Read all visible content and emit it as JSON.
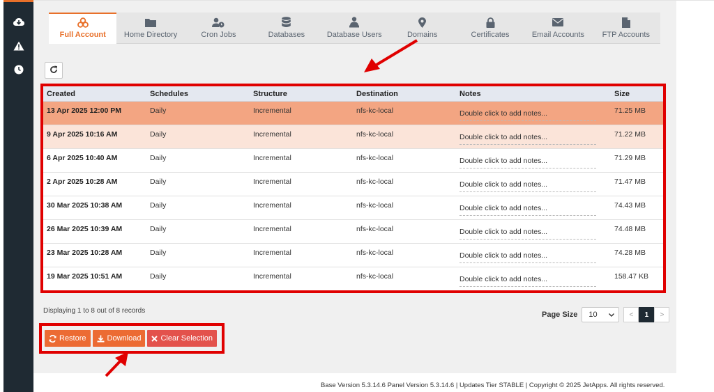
{
  "tabs": [
    {
      "label": "Full Account",
      "icon": "biohazard-icon",
      "active": true
    },
    {
      "label": "Home Directory",
      "icon": "folder-icon",
      "active": false
    },
    {
      "label": "Cron Jobs",
      "icon": "user-clock-icon",
      "active": false
    },
    {
      "label": "Databases",
      "icon": "database-icon",
      "active": false
    },
    {
      "label": "Database Users",
      "icon": "user-group-icon",
      "active": false
    },
    {
      "label": "Domains",
      "icon": "map-pin-icon",
      "active": false
    },
    {
      "label": "Certificates",
      "icon": "lock-icon",
      "active": false
    },
    {
      "label": "Email Accounts",
      "icon": "envelope-icon",
      "active": false
    },
    {
      "label": "FTP Accounts",
      "icon": "file-icon",
      "active": false
    }
  ],
  "table": {
    "headers": {
      "created": "Created",
      "schedules": "Schedules",
      "structure": "Structure",
      "destination": "Destination",
      "notes": "Notes",
      "size": "Size"
    },
    "rows": [
      {
        "created": "13 Apr 2025 12:00 PM",
        "schedules": "Daily",
        "structure": "Incremental",
        "destination": "nfs-kc-local",
        "notes": "Double click to add notes...",
        "size": "71.25 MB"
      },
      {
        "created": "9 Apr 2025 10:16 AM",
        "schedules": "Daily",
        "structure": "Incremental",
        "destination": "nfs-kc-local",
        "notes": "Double click to add notes...",
        "size": "71.22 MB"
      },
      {
        "created": "6 Apr 2025 10:40 AM",
        "schedules": "Daily",
        "structure": "Incremental",
        "destination": "nfs-kc-local",
        "notes": "Double click to add notes...",
        "size": "71.29 MB"
      },
      {
        "created": "2 Apr 2025 10:28 AM",
        "schedules": "Daily",
        "structure": "Incremental",
        "destination": "nfs-kc-local",
        "notes": "Double click to add notes...",
        "size": "71.47 MB"
      },
      {
        "created": "30 Mar 2025 10:38 AM",
        "schedules": "Daily",
        "structure": "Incremental",
        "destination": "nfs-kc-local",
        "notes": "Double click to add notes...",
        "size": "74.43 MB"
      },
      {
        "created": "26 Mar 2025 10:39 AM",
        "schedules": "Daily",
        "structure": "Incremental",
        "destination": "nfs-kc-local",
        "notes": "Double click to add notes...",
        "size": "74.48 MB"
      },
      {
        "created": "23 Mar 2025 10:28 AM",
        "schedules": "Daily",
        "structure": "Incremental",
        "destination": "nfs-kc-local",
        "notes": "Double click to add notes...",
        "size": "74.28 MB"
      },
      {
        "created": "19 Mar 2025 10:51 AM",
        "schedules": "Daily",
        "structure": "Incremental",
        "destination": "nfs-kc-local",
        "notes": "Double click to add notes...",
        "size": "158.47 KB"
      }
    ]
  },
  "records_text": "Displaying 1 to 8 out of 8 records",
  "pager": {
    "page_size_label": "Page Size",
    "page_size": "10",
    "prev": "<",
    "current_page": "1",
    "next": ">"
  },
  "actions": {
    "restore": "Restore",
    "download": "Download",
    "clear": "Clear Selection"
  },
  "footer": "Base Version 5.3.14.6 Panel Version 5.3.14.6 | Updates Tier STABLE | Copyright © 2025 JetApps. All rights reserved.",
  "colors": {
    "accent": "#e8702a",
    "sidebar": "#1f2a33",
    "highlight": "#e00000",
    "selected_row": "#f3a582",
    "selected_row_light": "#fbe4d9"
  }
}
